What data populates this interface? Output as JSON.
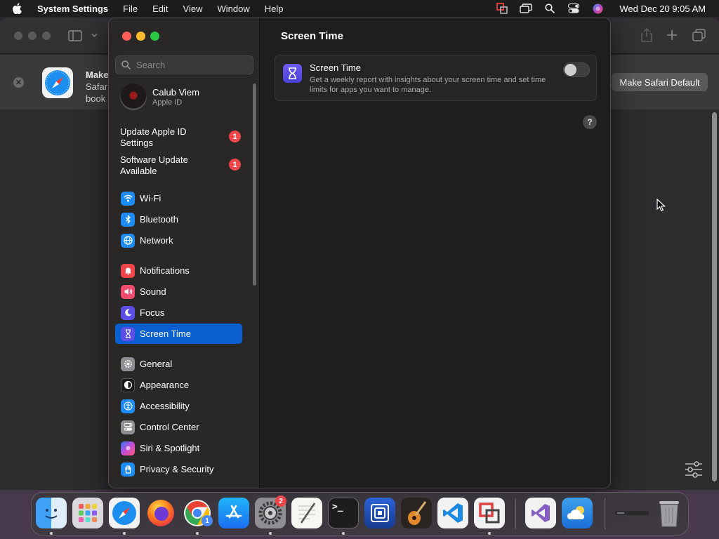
{
  "menubar": {
    "app_name": "System Settings",
    "menus": [
      "File",
      "Edit",
      "View",
      "Window",
      "Help"
    ],
    "clock": "Wed Dec 20  9:05 AM"
  },
  "safari": {
    "banner_title": "Make",
    "banner_line1": "Safar",
    "banner_line2": "book",
    "make_default_label": "Make Safari Default"
  },
  "settings": {
    "search_placeholder": "Search",
    "profile": {
      "name": "Calub Viem",
      "subtitle": "Apple ID"
    },
    "notices": [
      {
        "label": "Update Apple ID Settings",
        "badge": "1"
      },
      {
        "label": "Software Update Available",
        "badge": "1"
      }
    ],
    "sidebar": {
      "network": [
        "Wi-Fi",
        "Bluetooth",
        "Network"
      ],
      "focus_group": [
        "Notifications",
        "Sound",
        "Focus",
        "Screen Time"
      ],
      "general_group": [
        "General",
        "Appearance",
        "Accessibility",
        "Control Center",
        "Siri & Spotlight",
        "Privacy & Security"
      ]
    },
    "selected_item": "Screen Time",
    "main": {
      "title": "Screen Time",
      "card_title": "Screen Time",
      "card_desc": "Get a weekly report with insights about your screen time and set time limits for apps you want to manage.",
      "toggle_on": false,
      "help_label": "?"
    }
  },
  "dock": {
    "system_settings_badge": "2",
    "chrome_badge": "1",
    "terminal_label": ">_"
  },
  "colors": {
    "accent": "#0a5fd0",
    "badge": "#f0464a",
    "screen_time_icon": "#5b4de6"
  }
}
